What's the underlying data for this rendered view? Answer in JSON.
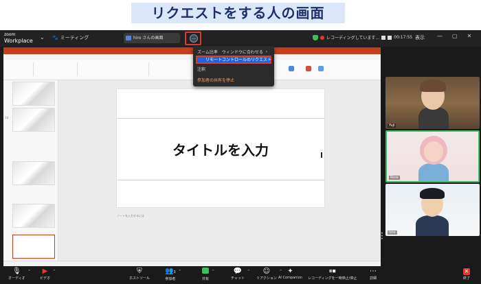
{
  "heading": "リクエストをする人の画面",
  "app": {
    "brand_line1": "zoom",
    "brand_line2": "Workplace",
    "meeting_label": "ミーティング",
    "share_tab": "hiro さんの画面",
    "more_icon": "ellipsis-icon",
    "recording_status": "レコーディングしています...",
    "clock": "00:17:55",
    "view_label": "表示"
  },
  "dropdown": {
    "item_fit": "ズーム比率　ウィンドウに合わせる",
    "item_request_remote": "リモートコントロールのリクエスト",
    "item_annotate": "注釈",
    "item_stop": "参加者の共有を停止"
  },
  "slide": {
    "title_text": "タイトルを入力",
    "notes_placeholder": "ノートを入力するには"
  },
  "participants": [
    {
      "name": "Yuji"
    },
    {
      "name": "Rose"
    },
    {
      "name": "hiro"
    }
  ],
  "toolbar": {
    "audio": "オーディオ",
    "video": "ビデオ",
    "host_tools": "ホストツール",
    "participants": "参加者",
    "participants_count": "3",
    "share": "共有",
    "chat": "チャット",
    "reactions": "リアクション",
    "ai": "AI Companion",
    "recording": "レコーディングを一時停止/停止",
    "more": "詳細",
    "end": "終了"
  }
}
